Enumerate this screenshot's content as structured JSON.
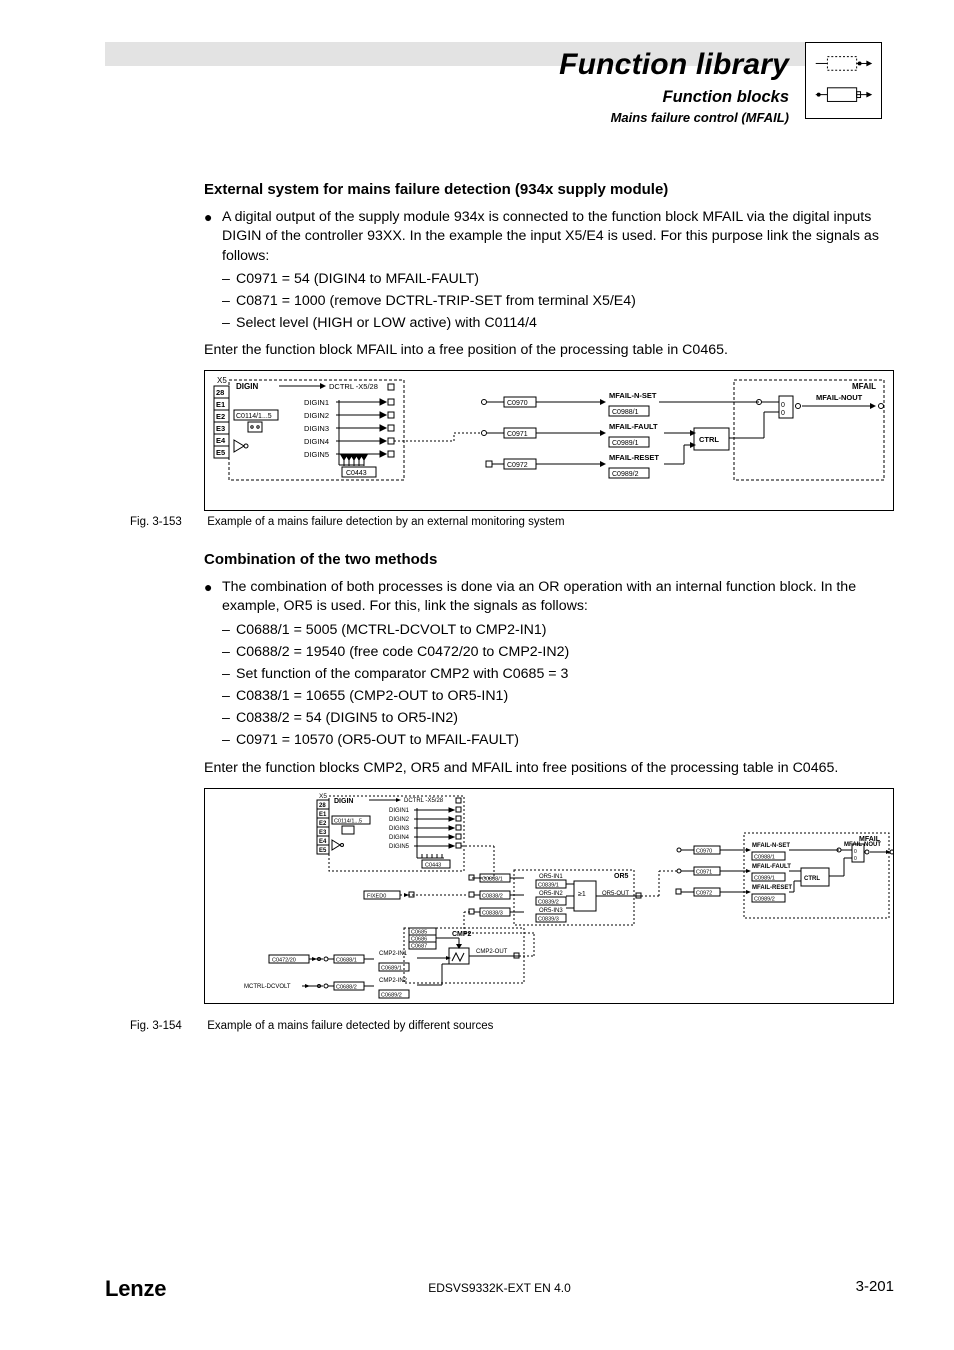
{
  "header": {
    "title": "Function library",
    "subtitle": "Function blocks",
    "subsub": "Mains failure control (MFAIL)"
  },
  "section1": {
    "heading": "External system for mains failure detection (934x supply module)",
    "bullet": "A digital output of the supply module 934x is connected to the function block MFAIL via the digital inputs DIGIN of the controller 93XX. In the example the input X5/E4 is used. For this purpose link the signals as follows:",
    "dashes": [
      "C0971 = 54 (DIGIN4 to MFAIL-FAULT)",
      "C0871 = 1000 (remove DCTRL-TRIP-SET from terminal X5/E4)",
      "Select level (HIGH or LOW active) with C0114/4"
    ],
    "tail": "Enter the function block MFAIL into a free position of the processing table in C0465."
  },
  "fig1": {
    "num": "Fig. 3-153",
    "cap": "Example of a mains failure detection by an external monitoring system"
  },
  "section2": {
    "heading": "Combination of the two methods",
    "bullet": "The combination of both processes is done via an OR operation with an internal function block. In the example, OR5 is used. For this, link the signals as follows:",
    "dashes": [
      "C0688/1 = 5005 (MCTRL-DCVOLT to CMP2-IN1)",
      "C0688/2 = 19540 (free code C0472/20 to CMP2-IN2)",
      "Set function of the comparator CMP2 with C0685 = 3",
      "C0838/1 = 10655 (CMP2-OUT to OR5-IN1)",
      "C0838/2 = 54 (DIGIN5 to OR5-IN2)",
      "C0971 = 10570 (OR5-OUT to MFAIL-FAULT)"
    ],
    "tail": "Enter the function blocks CMP2, OR5 and MFAIL into free positions of the processing table in C0465."
  },
  "fig2": {
    "num": "Fig. 3-154",
    "cap": "Example of a mains failure detected by different sources"
  },
  "diagram1": {
    "block_digin": "DIGIN",
    "x5": "X5",
    "pins": [
      "28",
      "E1",
      "E2",
      "E3",
      "E4",
      "E5"
    ],
    "c0114": "C0114/1...5",
    "digin_rows": [
      "DIGIN1",
      "DIGIN2",
      "DIGIN3",
      "DIGIN4",
      "DIGIN5"
    ],
    "c0443": "C0443",
    "dctrl": "DCTRL -X5/28",
    "c0970": "C0970",
    "c0971": "C0971",
    "c0972": "C0972",
    "mfail_nset": "MFAIL-N-SET",
    "mfail_fault": "MFAIL-FAULT",
    "mfail_reset": "MFAIL-RESET",
    "c0988_1": "C0988/1",
    "c0989_1": "C0989/1",
    "c0989_2": "C0989/2",
    "ctrl": "CTRL",
    "mfail": "MFAIL",
    "mfail_nout": "MFAIL-NOUT"
  },
  "diagram2": {
    "block_digin": "DIGIN",
    "x5": "X5",
    "pins": [
      "28",
      "E1",
      "E2",
      "E3",
      "E4",
      "E5"
    ],
    "c0114": "C0114/1...5",
    "digin_rows": [
      "DIGIN1",
      "DIGIN2",
      "DIGIN3",
      "DIGIN4",
      "DIGIN5"
    ],
    "c0443": "C0443",
    "dctrl": "DCTRL -X5/28",
    "fixed0": "FIXED0",
    "or5": "OR5",
    "or5_in1": "OR5-IN1",
    "or5_in2": "OR5-IN2",
    "or5_in3": "OR5-IN3",
    "or5_out": "OR5-OUT",
    "ge1": "≥1",
    "c0838_1": "C0838/1",
    "c0838_2": "C0838/2",
    "c0838_3": "C0838/3",
    "c0839_1": "C0839/1",
    "c0839_2": "C0839/2",
    "c0839_3": "C0839/3",
    "cmp2": "CMP2",
    "cmp2_in1": "CMP2-IN1",
    "cmp2_in2": "CMP2-IN2",
    "cmp2_out": "CMP2-OUT",
    "c0685": "C0685",
    "c0686": "C0686",
    "c0687": "C0687",
    "c0688_1": "C0688/1",
    "c0688_2": "C0688/2",
    "c0689_1": "C0689/1",
    "c0689_2": "C0689/2",
    "c0472_20": "C0472/20",
    "mctrl_dcvolt": "MCTRL-DCVOLT",
    "mfail": "MFAIL",
    "mfail_nset": "MFAIL-N-SET",
    "mfail_fault": "MFAIL-FAULT",
    "mfail_reset": "MFAIL-RESET",
    "mfail_nout": "MFAIL-NOUT",
    "c0970": "C0970",
    "c0971": "C0971",
    "c0972": "C0972",
    "c0988_1": "C0988/1",
    "c0989_1": "C0989/1",
    "c0989_2": "C0989/2",
    "ctrl": "CTRL"
  },
  "footer": {
    "brand": "Lenze",
    "doc": "EDSVS9332K-EXT EN 4.0",
    "page": "3-201"
  }
}
